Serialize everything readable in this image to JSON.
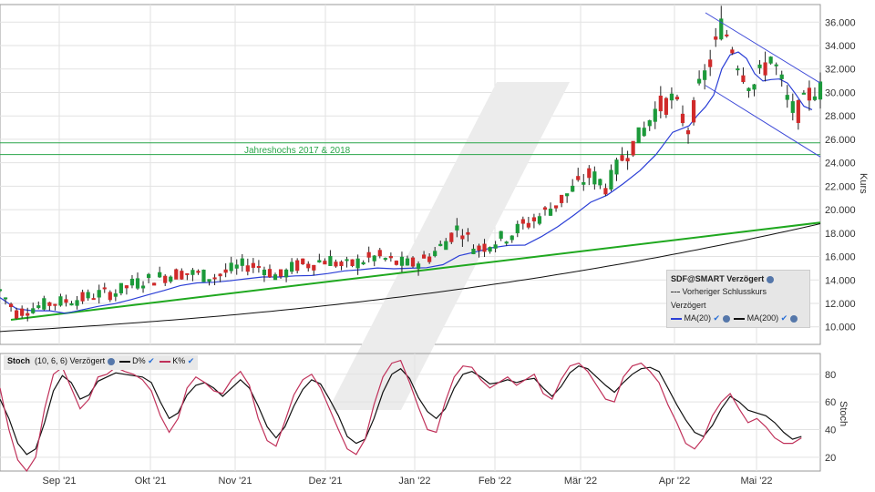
{
  "chart_data": [
    {
      "type": "candlestick",
      "ylabel": "Kurs",
      "ylim": [
        8.5,
        37.5
      ],
      "yticks": [
        "36.000",
        "34.000",
        "32.000",
        "30.000",
        "28.000",
        "26.000",
        "24.000",
        "22.000",
        "20.000",
        "18.000",
        "16.000",
        "14.000",
        "12.000",
        "10.000"
      ],
      "x_labels": [
        "Sep '21",
        "Okt '21",
        "Nov '21",
        "Dez '21",
        "Jan '22",
        "Feb '22",
        "Mär '22",
        "Apr '22",
        "Mai '22"
      ],
      "annotation": "Jahreshochs 2017 & 2018",
      "resistance_band": [
        25.7,
        24.7
      ],
      "series": [
        {
          "name": "MA(20)",
          "color": "#2b3fd6"
        },
        {
          "name": "MA(200)",
          "color": "#111111"
        }
      ],
      "trend_support": {
        "start": [
          0,
          10.6
        ],
        "end": [
          1,
          18.9
        ]
      },
      "channel_upper": {
        "start": [
          0.86,
          36.8
        ],
        "end": [
          1,
          30.8
        ]
      },
      "channel_lower": {
        "start": [
          0.86,
          30.6
        ],
        "end": [
          1,
          24.5
        ]
      },
      "close_points": [
        [
          0.0,
          13.1
        ],
        [
          0.02,
          11.2
        ],
        [
          0.04,
          11.6
        ],
        [
          0.06,
          12.0
        ],
        [
          0.08,
          12.2
        ],
        [
          0.1,
          12.4
        ],
        [
          0.12,
          12.8
        ],
        [
          0.14,
          12.9
        ],
        [
          0.16,
          13.6
        ],
        [
          0.18,
          14.0
        ],
        [
          0.2,
          14.3
        ],
        [
          0.22,
          14.6
        ],
        [
          0.24,
          14.5
        ],
        [
          0.26,
          14.2
        ],
        [
          0.28,
          14.8
        ],
        [
          0.3,
          15.3
        ],
        [
          0.32,
          15.1
        ],
        [
          0.34,
          14.2
        ],
        [
          0.36,
          15.2
        ],
        [
          0.38,
          15.4
        ],
        [
          0.4,
          15.8
        ],
        [
          0.42,
          15.1
        ],
        [
          0.44,
          15.6
        ],
        [
          0.46,
          16.0
        ],
        [
          0.48,
          15.5
        ],
        [
          0.5,
          15.3
        ],
        [
          0.52,
          15.8
        ],
        [
          0.54,
          17.0
        ],
        [
          0.56,
          18.6
        ],
        [
          0.58,
          16.6
        ],
        [
          0.6,
          17.2
        ],
        [
          0.62,
          17.8
        ],
        [
          0.64,
          18.7
        ],
        [
          0.66,
          19.5
        ],
        [
          0.68,
          20.6
        ],
        [
          0.7,
          21.8
        ],
        [
          0.72,
          23.0
        ],
        [
          0.74,
          21.9
        ],
        [
          0.76,
          24.6
        ],
        [
          0.78,
          26.2
        ],
        [
          0.8,
          28.6
        ],
        [
          0.82,
          29.4
        ],
        [
          0.84,
          26.8
        ],
        [
          0.85,
          29.7
        ],
        [
          0.86,
          31.6
        ],
        [
          0.87,
          33.4
        ],
        [
          0.88,
          35.8
        ],
        [
          0.89,
          34.4
        ],
        [
          0.9,
          32.6
        ],
        [
          0.91,
          31.2
        ],
        [
          0.92,
          30.6
        ],
        [
          0.93,
          31.9
        ],
        [
          0.94,
          33.1
        ],
        [
          0.95,
          31.4
        ],
        [
          0.96,
          29.2
        ],
        [
          0.97,
          28.1
        ],
        [
          0.98,
          29.0
        ],
        [
          0.99,
          30.2
        ]
      ],
      "legend": {
        "title": "SDF@SMART Verzögert",
        "prev_close": "Vorheriger Schlusskurs",
        "delayed": "Verzögert",
        "ma20": "MA(20)",
        "ma200": "MA(200)"
      }
    },
    {
      "type": "line",
      "ylabel": "Stoch",
      "ylim": [
        10,
        95
      ],
      "yticks": [
        "80",
        "60",
        "40",
        "20"
      ],
      "legend": {
        "name": "Stoch",
        "params": "(10, 6, 6) Verzögert",
        "d": "D%",
        "k": "K%"
      },
      "series": [
        {
          "name": "D%",
          "color": "#111111",
          "values": [
            62,
            48,
            30,
            22,
            26,
            45,
            68,
            79,
            74,
            62,
            65,
            75,
            78,
            81,
            80,
            79,
            78,
            74,
            60,
            48,
            52,
            65,
            72,
            74,
            70,
            64,
            70,
            76,
            70,
            57,
            42,
            34,
            42,
            57,
            69,
            76,
            73,
            62,
            50,
            35,
            30,
            33,
            48,
            67,
            80,
            84,
            77,
            63,
            53,
            48,
            55,
            70,
            80,
            82,
            78,
            73,
            74,
            76,
            74,
            76,
            77,
            70,
            64,
            71,
            81,
            86,
            84,
            78,
            72,
            67,
            74,
            80,
            84,
            85,
            82,
            70,
            58,
            47,
            38,
            35,
            43,
            55,
            64,
            60,
            54,
            52,
            50,
            45,
            38,
            33,
            35
          ]
        },
        {
          "name": "K%",
          "color": "#c0315a",
          "values": [
            70,
            40,
            18,
            10,
            20,
            55,
            80,
            85,
            70,
            55,
            62,
            78,
            80,
            85,
            82,
            80,
            76,
            68,
            50,
            38,
            48,
            70,
            78,
            74,
            68,
            66,
            76,
            82,
            72,
            48,
            32,
            28,
            46,
            65,
            76,
            80,
            70,
            55,
            40,
            26,
            22,
            33,
            58,
            78,
            88,
            90,
            74,
            56,
            40,
            38,
            60,
            78,
            86,
            85,
            76,
            70,
            74,
            78,
            72,
            76,
            80,
            66,
            62,
            76,
            86,
            88,
            82,
            72,
            62,
            60,
            78,
            86,
            88,
            82,
            74,
            58,
            45,
            30,
            26,
            34,
            50,
            60,
            66,
            55,
            45,
            48,
            42,
            34,
            30,
            30,
            34
          ]
        }
      ]
    }
  ]
}
